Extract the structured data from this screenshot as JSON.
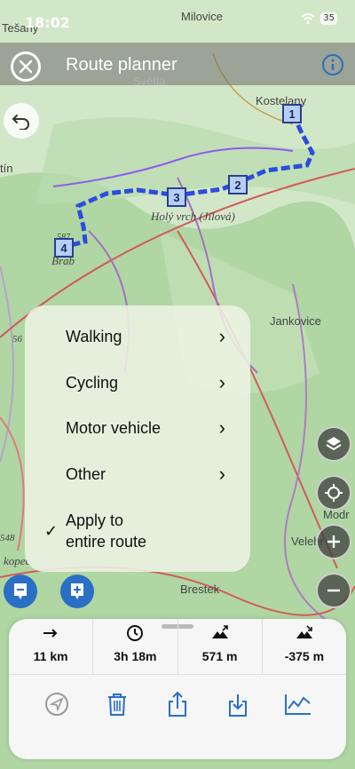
{
  "status_bar": {
    "time": "18:02",
    "battery": "35"
  },
  "header": {
    "title": "Route planner"
  },
  "map": {
    "labels": [
      "Tešany",
      "Milovice",
      "Světlá",
      "Kostelany",
      "Holý vrch (Jílová)",
      "Jankovice",
      "Brestek",
      "Modr",
      "Velehr",
      "Brab",
      "587",
      "56",
      "548",
      "kopec",
      "tín"
    ],
    "markers": [
      "1",
      "2",
      "3",
      "4"
    ]
  },
  "transport_menu": {
    "items": [
      {
        "label": "Walking"
      },
      {
        "label": "Cycling"
      },
      {
        "label": "Motor vehicle"
      },
      {
        "label": "Other"
      }
    ],
    "apply_line1": "Apply to",
    "apply_line2": "entire route"
  },
  "route_stats": {
    "distance": "11  km",
    "duration": "3h 18m",
    "ascent": "571  m",
    "descent": "-375  m"
  },
  "icons": [
    "close-icon",
    "info-icon",
    "undo-icon",
    "layers-icon",
    "locate-icon",
    "zoom-in-icon",
    "zoom-out-icon",
    "navigate-icon",
    "trash-icon",
    "share-icon",
    "download-icon",
    "elevation-chart-icon"
  ],
  "colors": {
    "route": "#2a4de0",
    "accent": "#2b6fc4"
  }
}
